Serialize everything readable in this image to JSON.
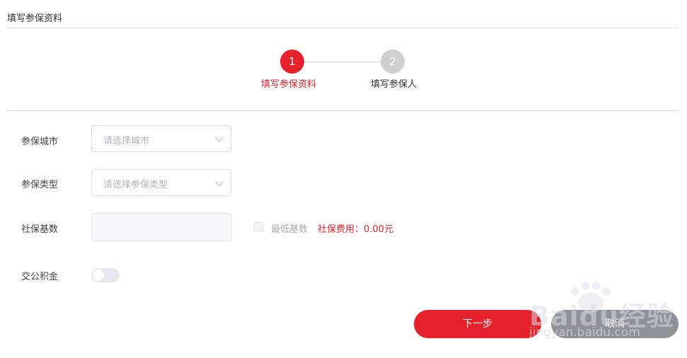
{
  "page": {
    "title": "填写参保资料"
  },
  "steps": [
    {
      "number": "1",
      "label": "填写参保资料",
      "state": "active"
    },
    {
      "number": "2",
      "label": "填写参保人",
      "state": "inactive"
    }
  ],
  "form": {
    "city": {
      "label": "参保城市",
      "placeholder": "请选择城市"
    },
    "insurance_type": {
      "label": "参保类型",
      "placeholder": "请选择参保类型"
    },
    "base": {
      "label": "社保基数",
      "value": "",
      "min_base_label": "最低基数",
      "min_base_checked": false,
      "fee_text": "社保费用：0.00元"
    },
    "housing_fund": {
      "label": "交公积金",
      "enabled": false
    }
  },
  "buttons": {
    "next": "下一步",
    "cancel": "取消"
  },
  "watermark": {
    "brand": "Baidu经验",
    "url": "jingyan.baidu.com"
  },
  "colors": {
    "accent": "#e5222b",
    "inactive": "#cfcfcf",
    "cancel": "#8e9197"
  }
}
